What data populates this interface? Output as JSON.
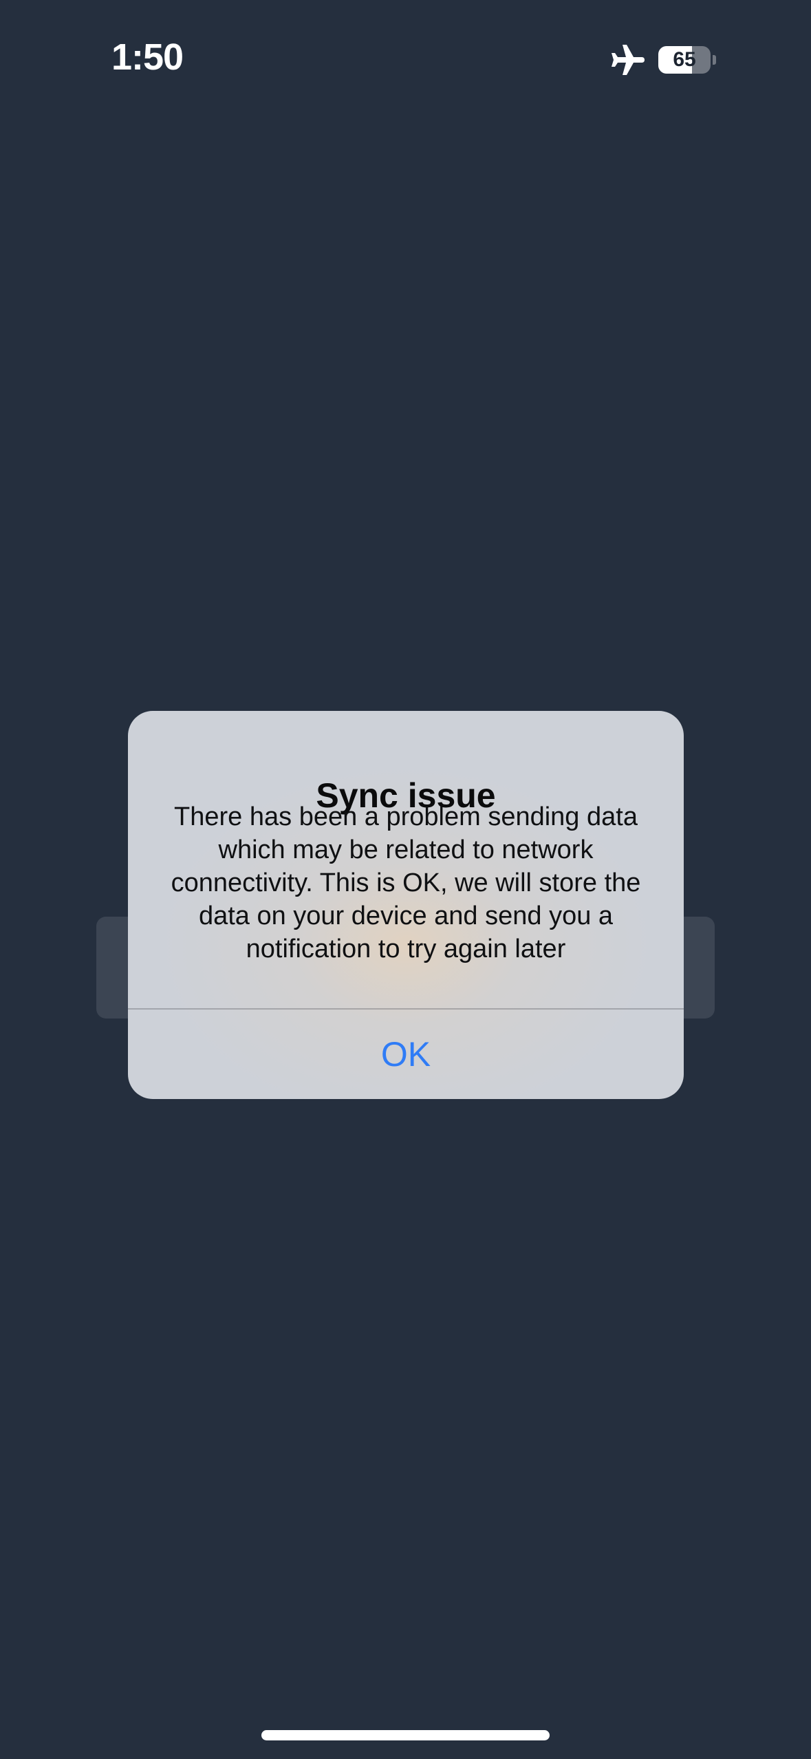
{
  "status_bar": {
    "time": "1:50",
    "battery_level": "65",
    "battery_fraction": 0.65,
    "airplane_icon": "airplane-icon"
  },
  "alert": {
    "title": "Sync issue",
    "message": "There has been a problem sending data which may be related to network connectivity. This is OK, we will store the data on your device and send you a notification to try again later",
    "ok_label": "OK"
  },
  "colors": {
    "background": "#252f3e",
    "alert_button": "#2f7cf6"
  }
}
